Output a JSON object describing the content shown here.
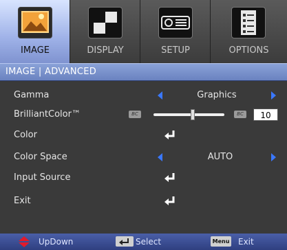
{
  "tabs": [
    {
      "label": "IMAGE",
      "icon": "image-icon",
      "active": true
    },
    {
      "label": "DISPLAY",
      "icon": "display-icon",
      "active": false
    },
    {
      "label": "SETUP",
      "icon": "setup-icon",
      "active": false
    },
    {
      "label": "OPTIONS",
      "icon": "options-icon",
      "active": false
    }
  ],
  "title": "IMAGE | ADVANCED",
  "rows": {
    "gamma": {
      "label": "Gamma",
      "value": "Graphics"
    },
    "brilliantcolor": {
      "label": "BrilliantColor™",
      "badge": "BC",
      "value": "10",
      "level_fraction": 0.55
    },
    "color": {
      "label": "Color"
    },
    "color_space": {
      "label": "Color Space",
      "value": "AUTO"
    },
    "input_source": {
      "label": "Input Source"
    },
    "exit": {
      "label": "Exit"
    }
  },
  "footer": {
    "updown": "UpDown",
    "select": "Select",
    "menu_key": "Menu",
    "exit": "Exit"
  },
  "colors": {
    "accent": "#3a78ff",
    "title_bar": "#7f93d0",
    "footer": "#3a4d94",
    "updown_arrow": "#e21b2b"
  }
}
